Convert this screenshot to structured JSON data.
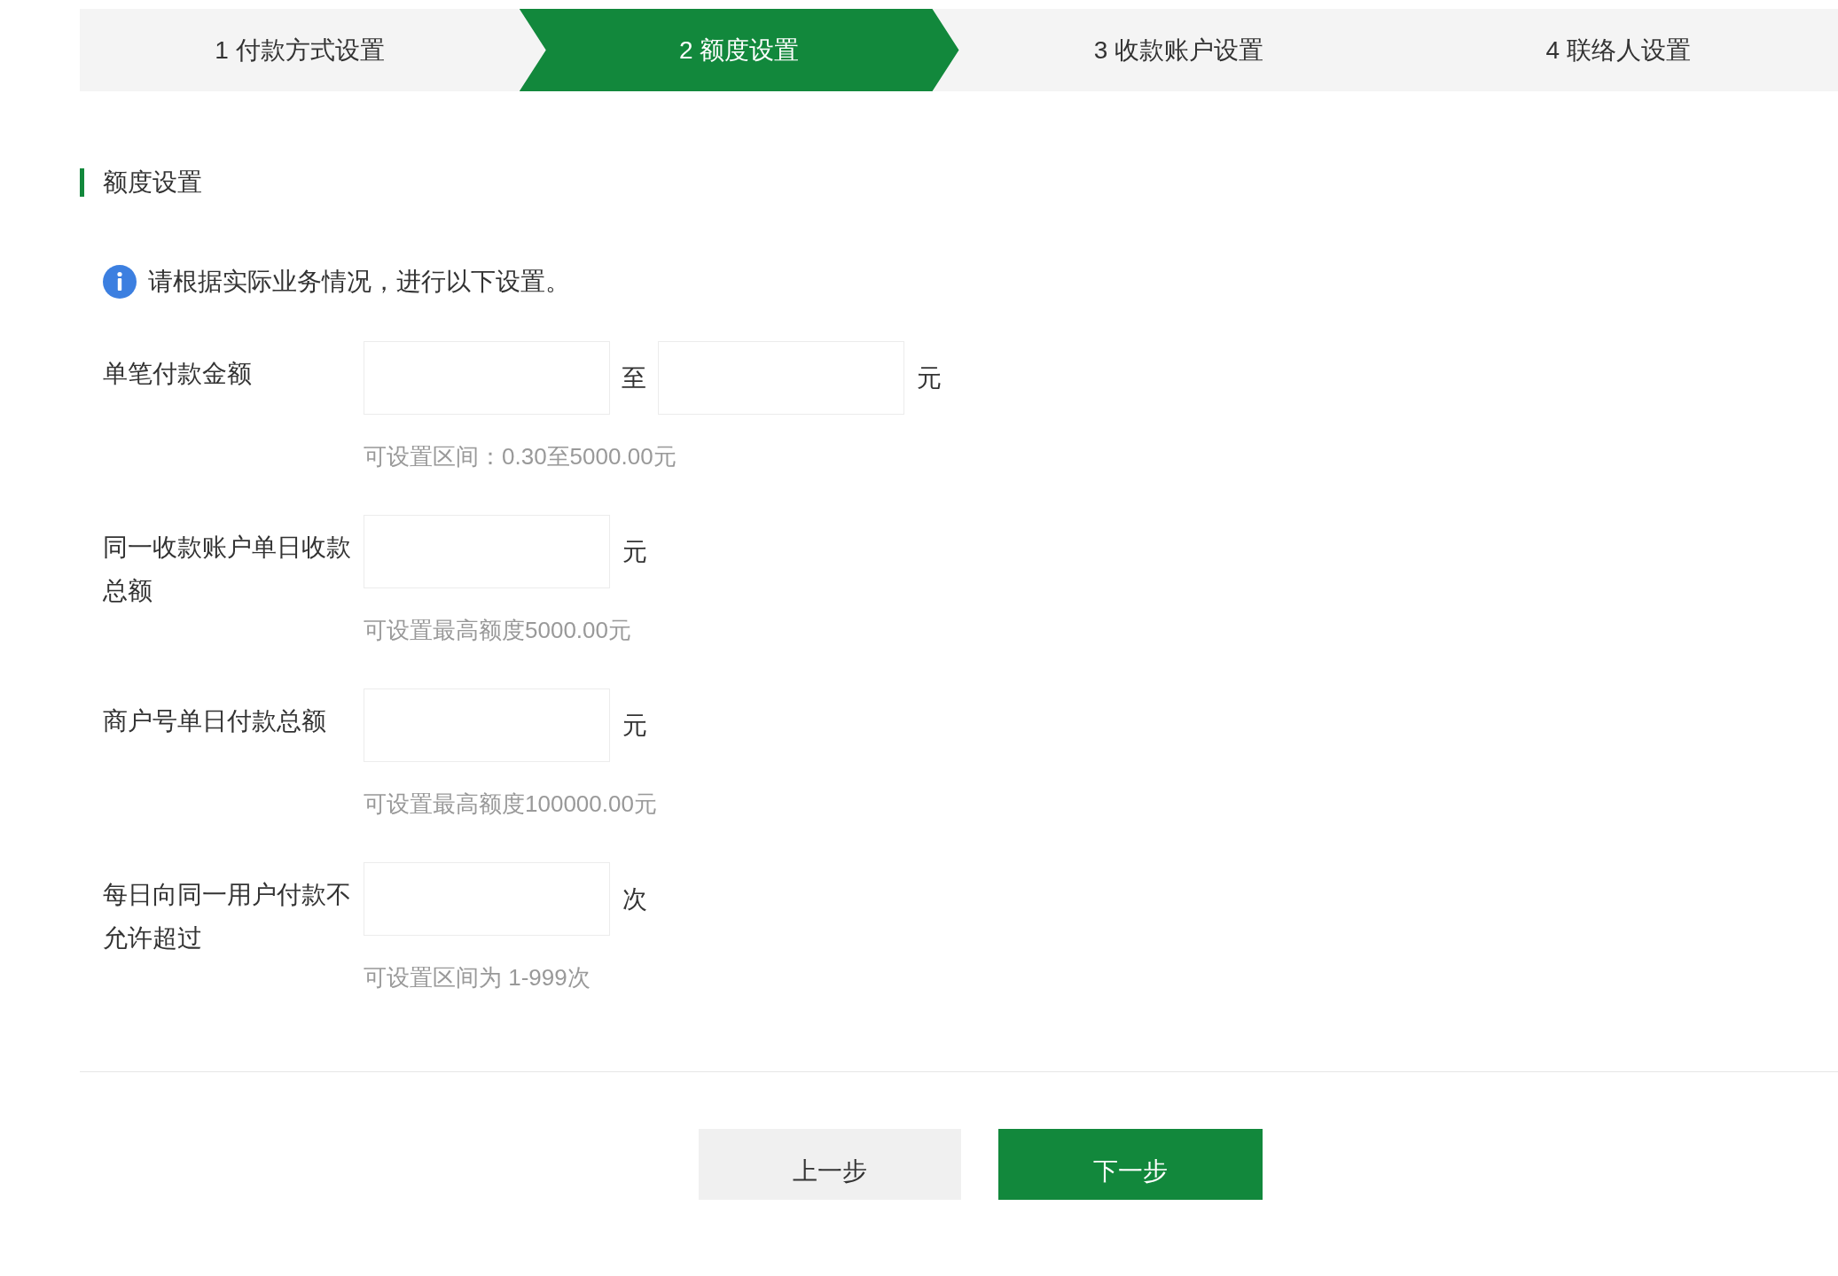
{
  "steps": [
    {
      "label": "1 付款方式设置",
      "selected": false
    },
    {
      "label": "2 额度设置",
      "selected": true
    },
    {
      "label": "3 收款账户设置",
      "selected": false
    },
    {
      "label": "4 联络人设置",
      "selected": false
    }
  ],
  "section_title": "额度设置",
  "info": "请根据实际业务情况，进行以下设置。",
  "fields": [
    {
      "kind": "range",
      "label": "单笔付款金额",
      "separator": "至",
      "unit": "元",
      "hint": "可设置区间：0.30至5000.00元"
    },
    {
      "kind": "single",
      "label": "同一收款账户单日收款总额",
      "unit": "元",
      "hint": "可设置最高额度5000.00元"
    },
    {
      "kind": "single",
      "label": "商户号单日付款总额",
      "unit": "元",
      "hint": "可设置最高额度100000.00元"
    },
    {
      "kind": "single",
      "label": "每日向同一用户付款不允许超过",
      "unit": "次",
      "hint": "可设置区间为 1-999次"
    }
  ],
  "buttons": [
    {
      "label": "上一步",
      "kind": "secondary"
    },
    {
      "label": "下一步",
      "kind": "primary"
    }
  ]
}
